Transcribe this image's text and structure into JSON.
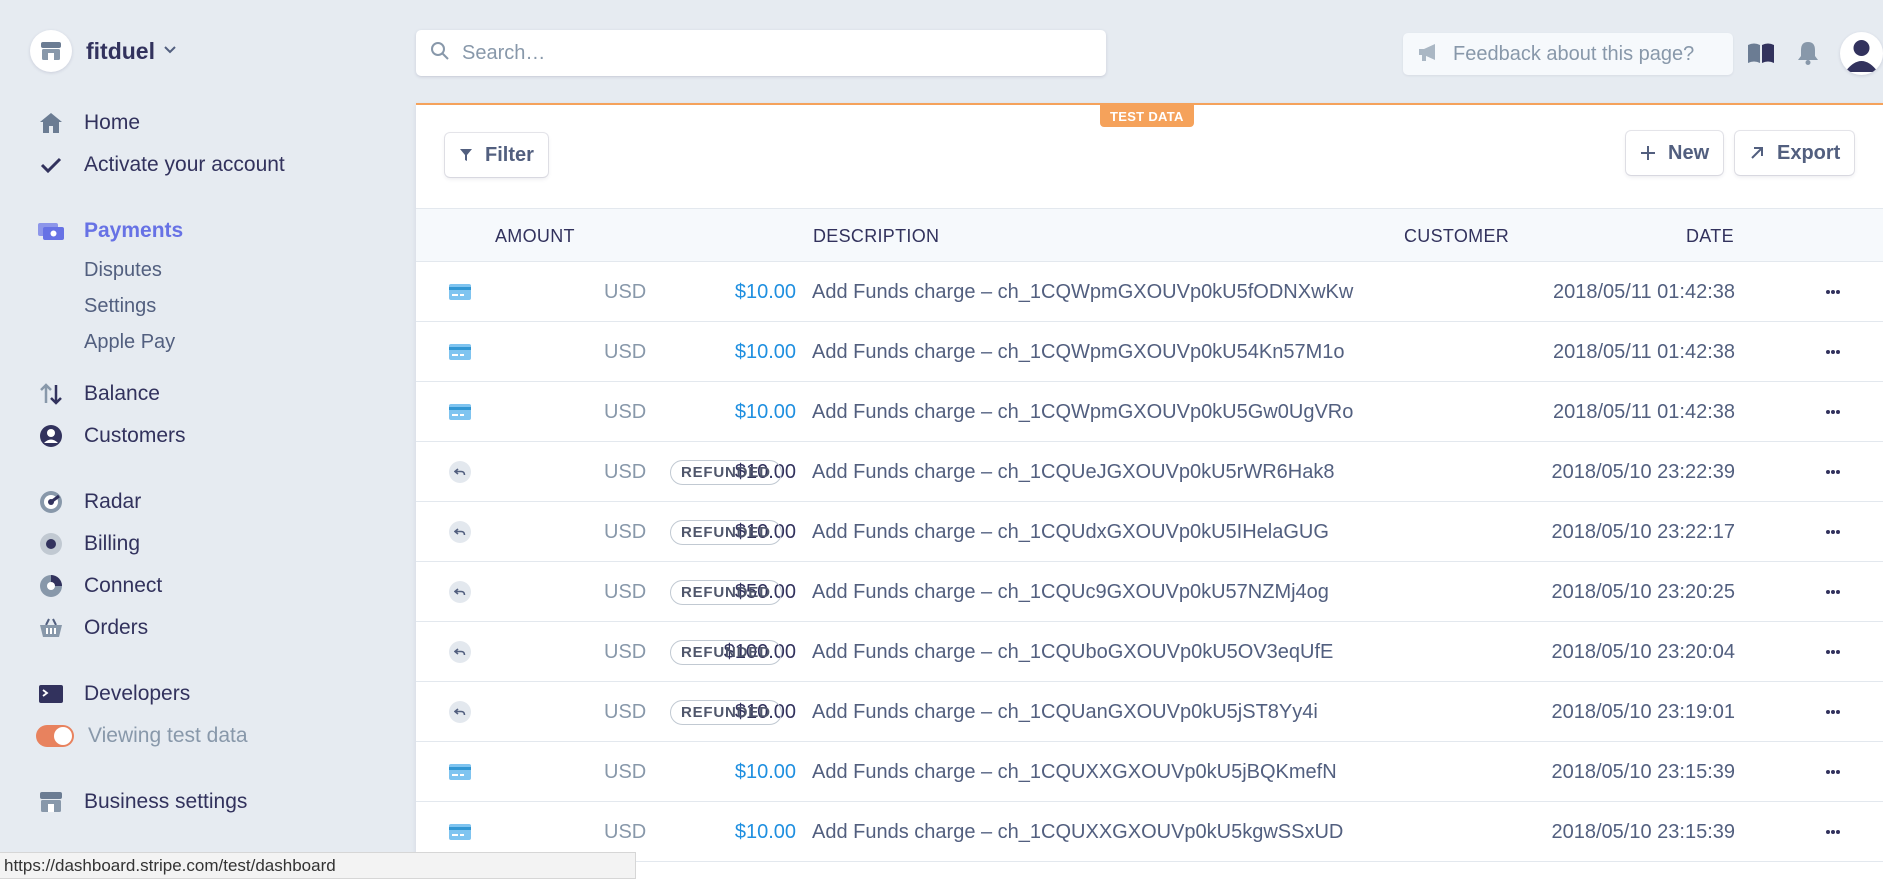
{
  "account": {
    "name": "fitduel"
  },
  "nav": {
    "home": "Home",
    "activate": "Activate your account",
    "payments": "Payments",
    "disputes": "Disputes",
    "settings": "Settings",
    "apple_pay": "Apple Pay",
    "balance": "Balance",
    "customers": "Customers",
    "radar": "Radar",
    "billing": "Billing",
    "connect": "Connect",
    "orders": "Orders",
    "developers": "Developers",
    "viewing_test_data": "Viewing test data",
    "business_settings": "Business settings"
  },
  "search": {
    "placeholder": "Search…",
    "value": ""
  },
  "feedback": {
    "placeholder": "Feedback about this page?"
  },
  "panel": {
    "test_badge": "TEST DATA",
    "filter_label": "Filter",
    "new_label": "New",
    "export_label": "Export"
  },
  "table": {
    "headers": {
      "amount": "AMOUNT",
      "description": "DESCRIPTION",
      "customer": "CUSTOMER",
      "date": "DATE"
    },
    "rows": [
      {
        "icon": "card-icon",
        "amount": "$10.00",
        "currency": "USD",
        "status": "",
        "description": "Add Funds charge – ch_1CQWpmGXOUVp0kU5fODNXwKw",
        "date": "2018/05/11 01:42:38"
      },
      {
        "icon": "card-icon",
        "amount": "$10.00",
        "currency": "USD",
        "status": "",
        "description": "Add Funds charge – ch_1CQWpmGXOUVp0kU54Kn57M1o",
        "date": "2018/05/11 01:42:38"
      },
      {
        "icon": "card-icon",
        "amount": "$10.00",
        "currency": "USD",
        "status": "",
        "description": "Add Funds charge – ch_1CQWpmGXOUVp0kU5Gw0UgVRo",
        "date": "2018/05/11 01:42:38"
      },
      {
        "icon": "refund-icon",
        "amount": "$10.00",
        "currency": "USD",
        "status": "REFUNDED",
        "description": "Add Funds charge – ch_1CQUeJGXOUVp0kU5rWR6Hak8",
        "date": "2018/05/10 23:22:39"
      },
      {
        "icon": "refund-icon",
        "amount": "$10.00",
        "currency": "USD",
        "status": "REFUNDED",
        "description": "Add Funds charge – ch_1CQUdxGXOUVp0kU5IHelaGUG",
        "date": "2018/05/10 23:22:17"
      },
      {
        "icon": "refund-icon",
        "amount": "$50.00",
        "currency": "USD",
        "status": "REFUNDED",
        "description": "Add Funds charge – ch_1CQUc9GXOUVp0kU57NZMj4og",
        "date": "2018/05/10 23:20:25"
      },
      {
        "icon": "refund-icon",
        "amount": "$100.00",
        "currency": "USD",
        "status": "REFUNDED",
        "description": "Add Funds charge – ch_1CQUboGXOUVp0kU5OV3eqUfE",
        "date": "2018/05/10 23:20:04"
      },
      {
        "icon": "refund-icon",
        "amount": "$10.00",
        "currency": "USD",
        "status": "REFUNDED",
        "description": "Add Funds charge – ch_1CQUanGXOUVp0kU5jST8Yy4i",
        "date": "2018/05/10 23:19:01"
      },
      {
        "icon": "card-icon",
        "amount": "$10.00",
        "currency": "USD",
        "status": "",
        "description": "Add Funds charge – ch_1CQUXXGXOUVp0kU5jBQKmefN",
        "date": "2018/05/10 23:15:39"
      },
      {
        "icon": "card-icon",
        "amount": "$10.00",
        "currency": "USD",
        "status": "",
        "description": "Add Funds charge – ch_1CQUXXGXOUVp0kU5kgwSSxUD",
        "date": "2018/05/10 23:15:39"
      }
    ]
  },
  "statusbar": {
    "url": "https://dashboard.stripe.com/test/dashboard"
  },
  "colors": {
    "accent": "#6772e5",
    "link": "#1f8fe0",
    "test_data": "#f5a25b",
    "toggle": "#e8825e"
  }
}
